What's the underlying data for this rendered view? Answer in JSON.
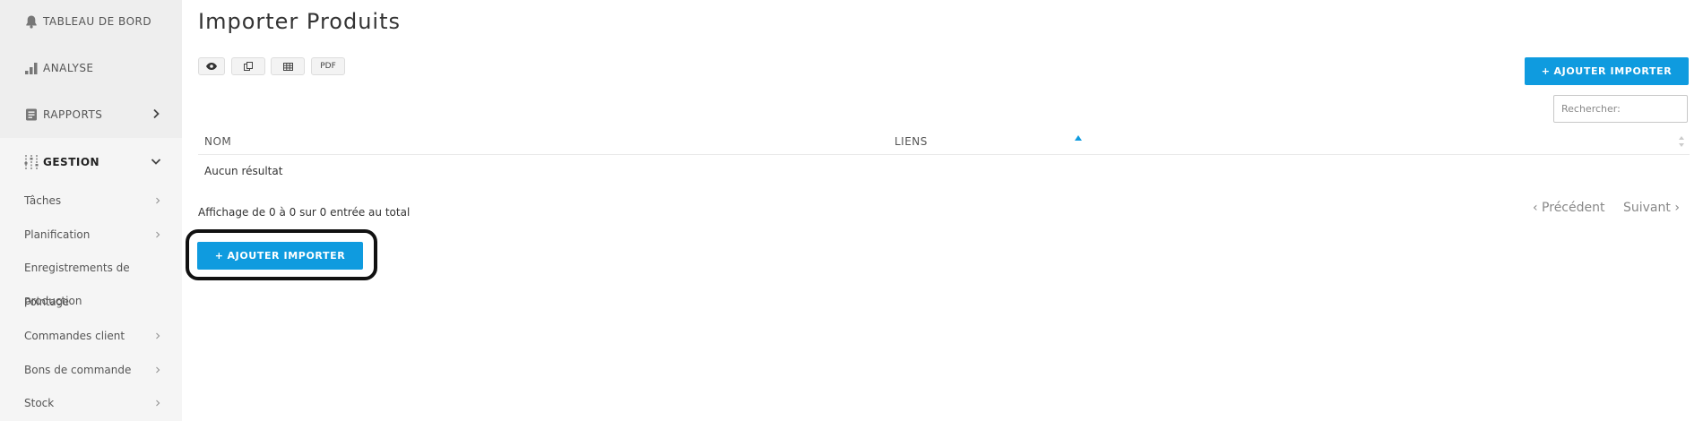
{
  "sidebar": {
    "items": [
      {
        "label": "TABLEAU DE BORD",
        "icon": "bell-icon"
      },
      {
        "label": "ANALYSE",
        "icon": "bar-chart-icon"
      },
      {
        "label": "RAPPORTS",
        "icon": "report-icon"
      },
      {
        "label": "GESTION",
        "icon": "sliders-icon"
      }
    ],
    "sub_items": [
      "Tâches",
      "Planification",
      "Enregistrements de",
      "Commandes client",
      "Bons de commande",
      "Stock"
    ],
    "overlap_a": "production",
    "overlap_b": "Pointage"
  },
  "page": {
    "title": "Importer Produits"
  },
  "toolbar": {
    "pdf_label": "PDF"
  },
  "actions": {
    "add_label": "AJOUTER IMPORTER",
    "add_prefix": "+"
  },
  "search": {
    "placeholder": "Rechercher:"
  },
  "table": {
    "columns": [
      "NOM",
      "LIENS"
    ],
    "empty_message": "Aucun résultat"
  },
  "footer": {
    "info": "Affichage de 0 à 0 sur 0 entrée au total",
    "prev_label": "‹ Précédent",
    "next_label": "Suivant ›"
  },
  "colors": {
    "accent": "#0f9bdf",
    "sidebar_bg": "#f5f5f5"
  }
}
